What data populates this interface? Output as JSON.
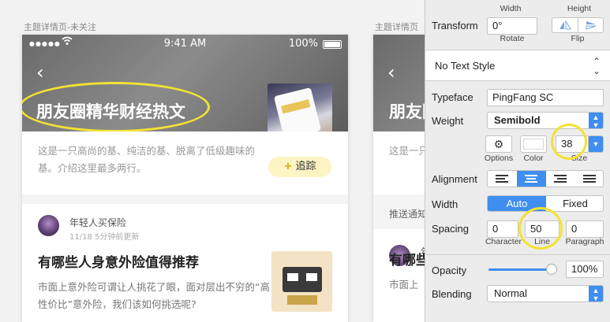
{
  "colors": {
    "accent": "#3f8ef0",
    "highlight": "#f2e233",
    "follow_bg": "#fdf4c4",
    "follow_plus": "#d8a800"
  },
  "frames": {
    "frame1_caption": "主题详情页-未关注",
    "frame2_caption": "主题详情页"
  },
  "phone1": {
    "status": {
      "signal": "●●●●●",
      "wifi": "wifi-icon",
      "time": "9:41 AM",
      "battery": "100%"
    },
    "back": "‹",
    "hero_title": "朋友圈精华财经热文",
    "description": "这是一只高尚的基、纯洁的基、脱离了低级趣味的基。介绍这里最多两行。",
    "follow_button": {
      "plus": "+",
      "label": "追踪"
    },
    "post": {
      "author": "年轻人买保险",
      "meta": "11/18  5分钟前更新",
      "title": "有哪些人身意外险值得推荐",
      "excerpt": "市面上意外险可谓让人挑花了眼，面对层出不穷的“高性价比”意外险，我们该如何挑选呢?"
    }
  },
  "phone2": {
    "back": "‹",
    "hero_title": "朋友圈",
    "description": "这是一只",
    "notice": "推送通知",
    "author": "年",
    "post_title": "有哪些",
    "excerpt": "市面上"
  },
  "inspector": {
    "width_caption": "Width",
    "height_caption": "Height",
    "transform_label": "Transform",
    "rotate_value": "0°",
    "rotate_caption": "Rotate",
    "flip_caption": "Flip",
    "text_style": "No Text Style",
    "typeface_label": "Typeface",
    "typeface_value": "PingFang SC",
    "weight_label": "Weight",
    "weight_value": "Semibold",
    "options_caption": "Options",
    "color_caption": "Color",
    "size_value": "38",
    "size_caption": "Size",
    "alignment_label": "Alignment",
    "width_label": "Width",
    "width_auto": "Auto",
    "width_fixed": "Fixed",
    "spacing_label": "Spacing",
    "character_value": "0",
    "character_caption": "Character",
    "line_value": "50",
    "line_caption": "Line",
    "paragraph_value": "0",
    "paragraph_caption": "Paragraph",
    "opacity_label": "Opacity",
    "opacity_value": "100%",
    "opacity_fraction": 1.0,
    "blending_label": "Blending",
    "blending_value": "Normal"
  }
}
